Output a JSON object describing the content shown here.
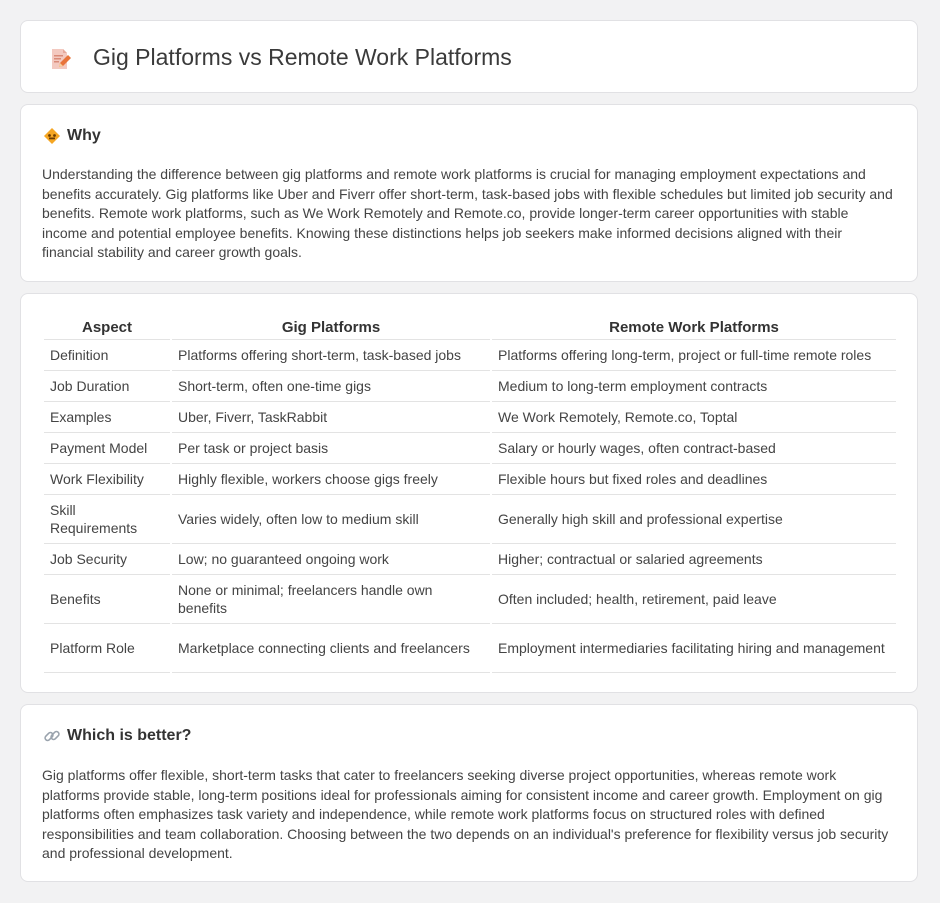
{
  "header": {
    "title": "Gig Platforms vs Remote Work Platforms",
    "icon": "document-pencil-icon"
  },
  "why": {
    "heading": "Why",
    "icon": "warning-diamond-icon",
    "text": "Understanding the difference between gig platforms and remote work platforms is crucial for managing employment expectations and benefits accurately. Gig platforms like Uber and Fiverr offer short-term, task-based jobs with flexible schedules but limited job security and benefits. Remote work platforms, such as We Work Remotely and Remote.co, provide longer-term career opportunities with stable income and potential employee benefits. Knowing these distinctions helps job seekers make informed decisions aligned with their financial stability and career growth goals."
  },
  "table": {
    "headers": [
      "Aspect",
      "Gig Platforms",
      "Remote Work Platforms"
    ],
    "rows": [
      [
        "Definition",
        "Platforms offering short-term, task-based jobs",
        "Platforms offering long-term, project or full-time remote roles"
      ],
      [
        "Job Duration",
        "Short-term, often one-time gigs",
        "Medium to long-term employment contracts"
      ],
      [
        "Examples",
        "Uber, Fiverr, TaskRabbit",
        "We Work Remotely, Remote.co, Toptal"
      ],
      [
        "Payment Model",
        "Per task or project basis",
        "Salary or hourly wages, often contract-based"
      ],
      [
        "Work Flexibility",
        "Highly flexible, workers choose gigs freely",
        "Flexible hours but fixed roles and deadlines"
      ],
      [
        "Skill Requirements",
        "Varies widely, often low to medium skill",
        "Generally high skill and professional expertise"
      ],
      [
        "Job Security",
        "Low; no guaranteed ongoing work",
        "Higher; contractual or salaried agreements"
      ],
      [
        "Benefits",
        "None or minimal; freelancers handle own benefits",
        "Often included; health, retirement, paid leave"
      ],
      [
        "Platform Role",
        "Marketplace connecting clients and freelancers",
        "Employment intermediaries facilitating hiring and management"
      ]
    ]
  },
  "better": {
    "heading": "Which is better?",
    "icon": "link-icon",
    "text": "Gig platforms offer flexible, short-term tasks that cater to freelancers seeking diverse project opportunities, whereas remote work platforms provide stable, long-term positions ideal for professionals aiming for consistent income and career growth. Employment on gig platforms often emphasizes task variety and independence, while remote work platforms focus on structured roles with defined responsibilities and team collaboration. Choosing between the two depends on an individual's preference for flexibility versus job security and professional development."
  }
}
